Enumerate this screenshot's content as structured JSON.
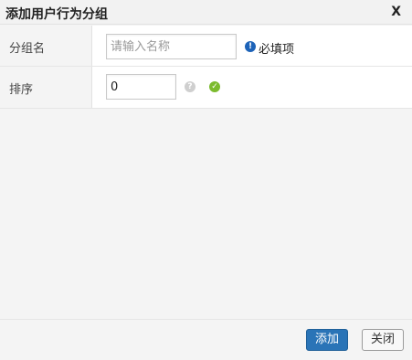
{
  "dialog": {
    "title": "添加用户行为分组",
    "close_label": "X"
  },
  "form": {
    "fields": [
      {
        "label": "分组名",
        "value": "",
        "placeholder": "请输入名称",
        "hint_icon": "info-icon",
        "hint": "必填项"
      },
      {
        "label": "排序",
        "value": "0",
        "help_icon": "question-icon",
        "status_icon": "check-icon"
      }
    ]
  },
  "footer": {
    "add_label": "添加",
    "close_label": "关闭"
  },
  "colors": {
    "primary_button": "#2a74b7",
    "info_icon": "#1d63b8",
    "ok_icon": "#7cbb2e",
    "help_icon": "#cfcfcf"
  }
}
